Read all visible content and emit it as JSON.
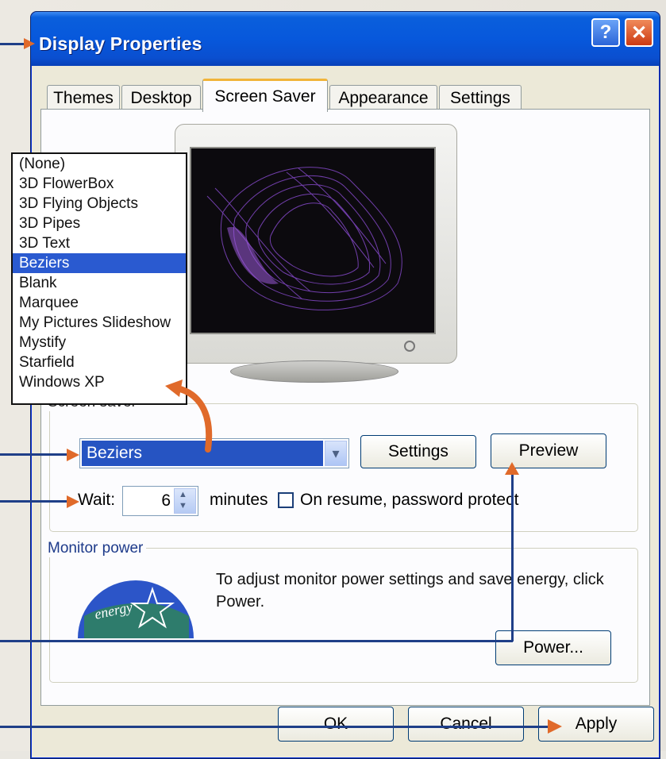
{
  "window": {
    "title": "Display Properties",
    "help_label": "?",
    "close_label": "✕"
  },
  "tabs": [
    {
      "label": "Themes"
    },
    {
      "label": "Desktop"
    },
    {
      "label": "Screen Saver",
      "active": true
    },
    {
      "label": "Appearance"
    },
    {
      "label": "Settings"
    }
  ],
  "screensaver_list": {
    "items": [
      "(None)",
      "3D FlowerBox",
      "3D Flying Objects",
      "3D Pipes",
      "3D Text",
      "Beziers",
      "Blank",
      "Marquee",
      "My Pictures Slideshow",
      "Mystify",
      "Starfield",
      "Windows XP"
    ],
    "selected": "Beziers"
  },
  "screen_saver": {
    "group_label": "Screen saver",
    "selected_value": "Beziers",
    "settings_label": "Settings",
    "preview_label": "Preview",
    "wait_label": "Wait:",
    "wait_value": "6",
    "minutes_label": "minutes",
    "password_label": "On resume, password protect",
    "password_checked": false
  },
  "monitor_power": {
    "group_label": "Monitor power",
    "description": "To adjust monitor power settings and save energy, click Power.",
    "power_label": "Power...",
    "logo_text": "energy"
  },
  "footer": {
    "ok_label": "OK",
    "cancel_label": "Cancel",
    "apply_label": "Apply"
  },
  "colors": {
    "titlebar": "#0a5fdc",
    "selection": "#2654c2",
    "accent_tab": "#f1b43a",
    "annotation_line": "#1f3f88",
    "annotation_arrow": "#e06a2a"
  }
}
